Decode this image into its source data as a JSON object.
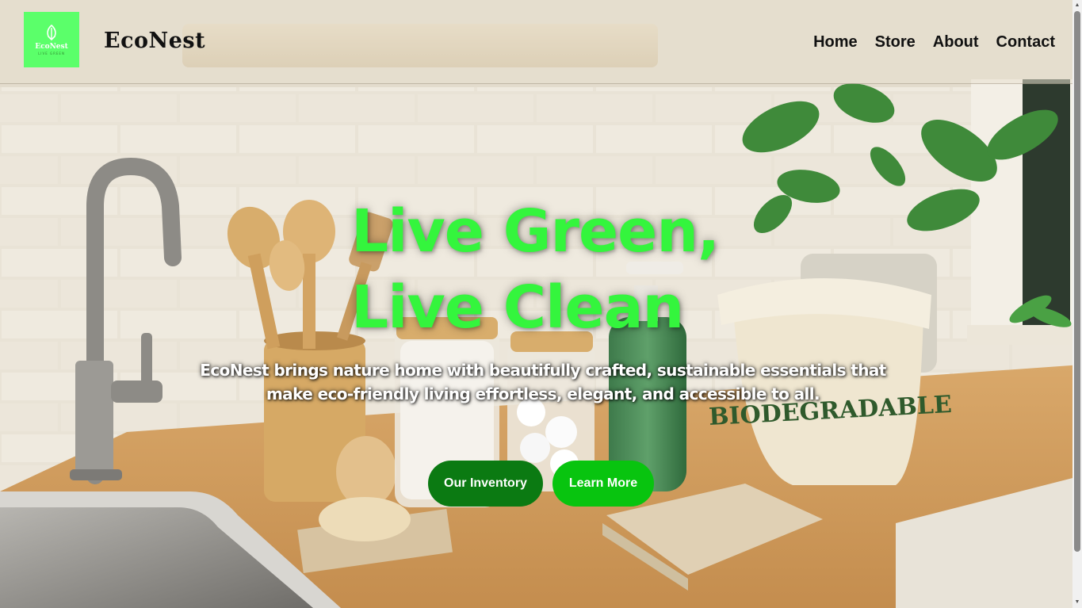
{
  "header": {
    "logo_text": "EcoNest",
    "logo_tagline": "LIVE GREEN",
    "brand": "EcoNest",
    "nav": [
      {
        "label": "Home"
      },
      {
        "label": "Store"
      },
      {
        "label": "About"
      },
      {
        "label": "Contact"
      }
    ]
  },
  "hero": {
    "title_line1": "Live Green,",
    "title_line2": "Live Clean",
    "subtitle_line1": "EcoNest brings nature home with beautifully crafted, sustainable essentials that",
    "subtitle_line2": "make eco-friendly living effortless, elegant, and accessible to all.",
    "buttons": {
      "inventory": "Our Inventory",
      "learn_more": "Learn More"
    },
    "background_bag_label": "BIODEGRADABLE"
  },
  "colors": {
    "accent_green": "#34f53d",
    "logo_bg": "#5bff6a",
    "btn_dark": "#0b7a12",
    "btn_bright": "#08c40f"
  }
}
